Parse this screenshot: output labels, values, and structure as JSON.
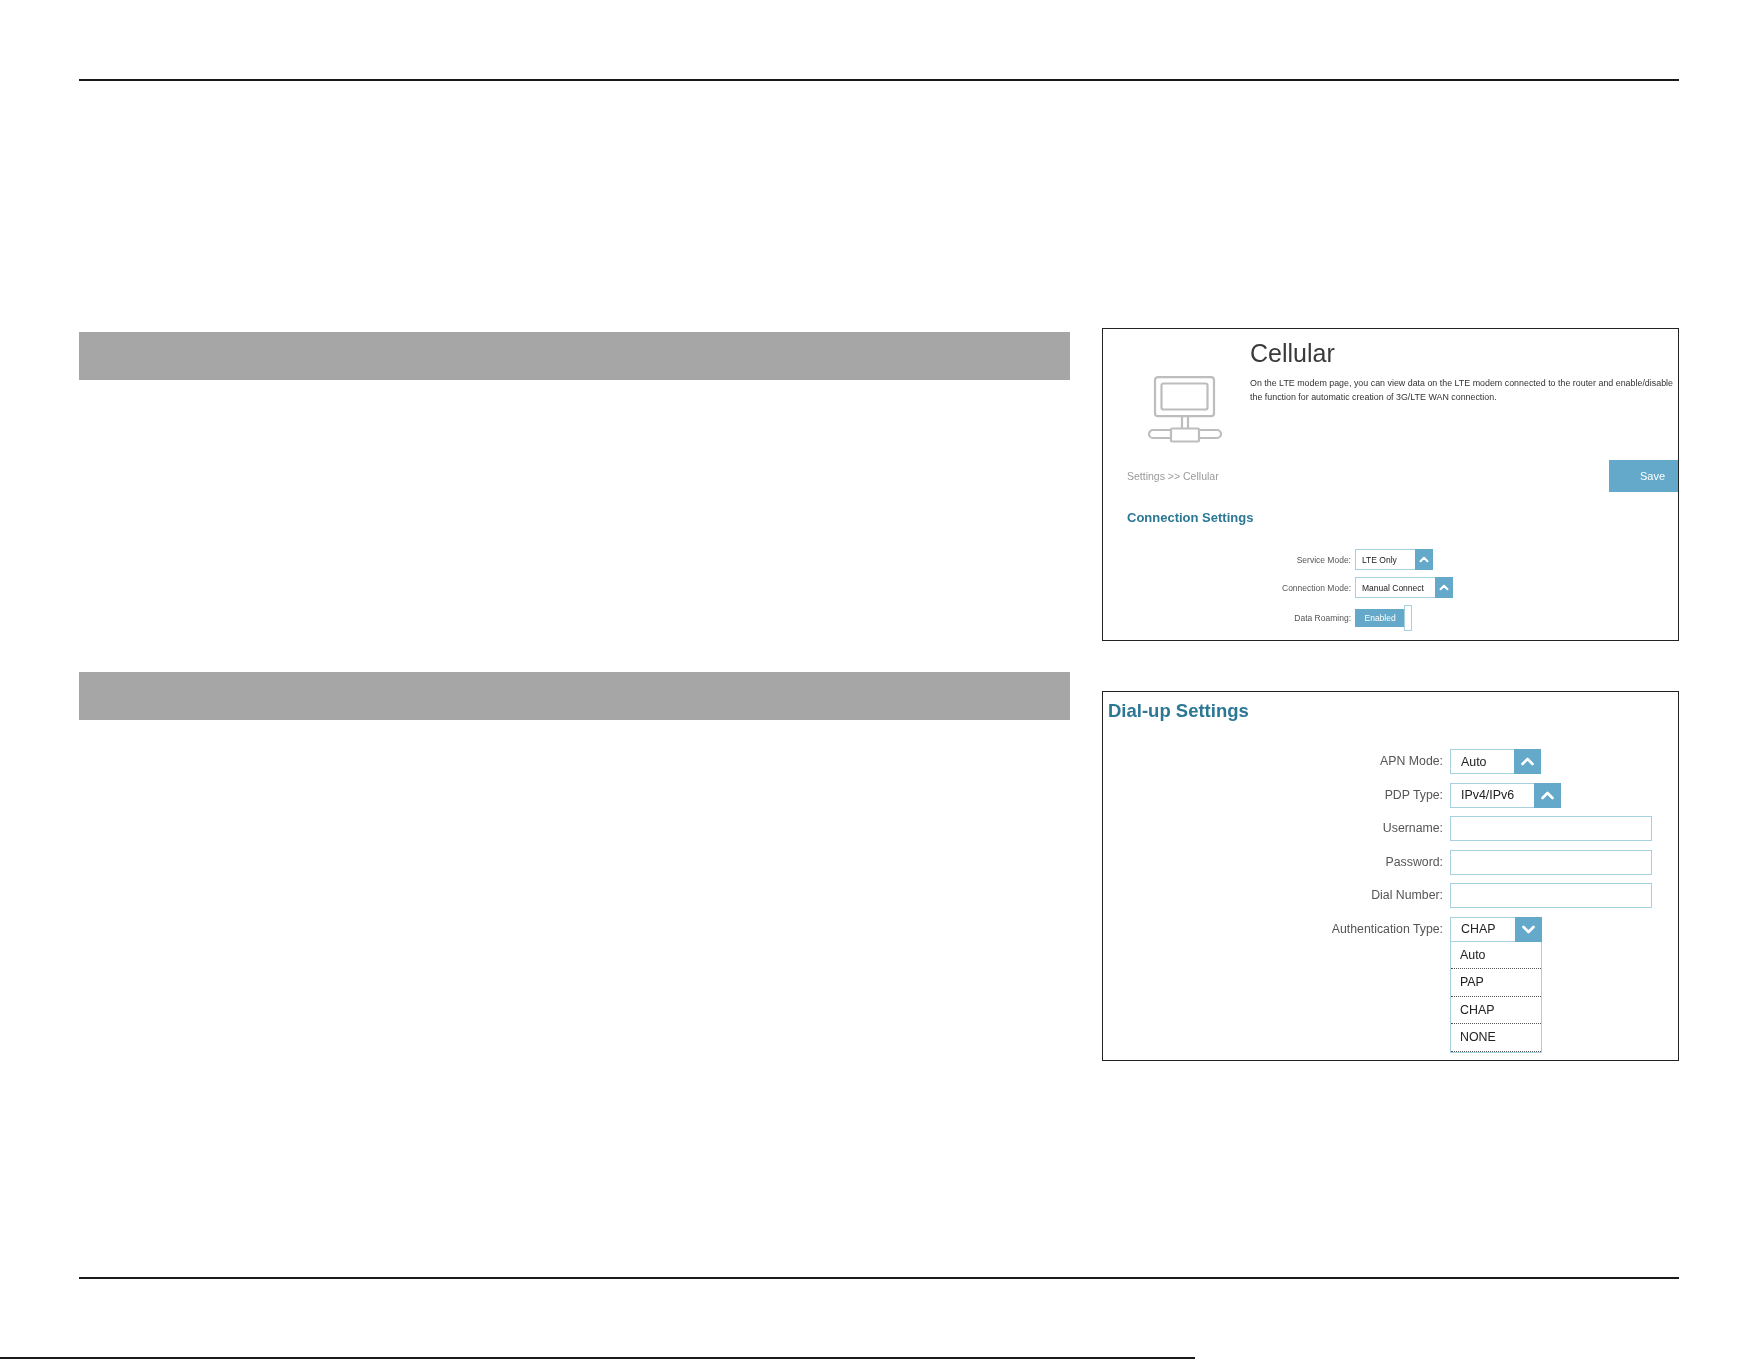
{
  "sections": [
    {
      "screenshot": {
        "title": "Cellular",
        "description": "On the LTE modem page, you can view data on the LTE modem connected to the router and enable/disable the function for automatic creation of 3G/LTE WAN connection.",
        "breadcrumb": "Settings >> Cellular",
        "button": "Save",
        "heading": "Connection Settings",
        "rows": [
          {
            "kind": "select",
            "label": "Service Mode:",
            "value": "LTE Only",
            "expanded": false
          },
          {
            "kind": "select",
            "label": "Connection Mode:",
            "value": "Manual Connect",
            "expanded": false
          },
          {
            "kind": "toggle",
            "label": "Data Roaming:",
            "value": "Enabled",
            "on": true
          }
        ]
      }
    },
    {
      "screenshot": {
        "heading": "Dial-up Settings",
        "rows": [
          {
            "kind": "select",
            "label": "APN Mode:",
            "value": "Auto",
            "expanded": false
          },
          {
            "kind": "select",
            "label": "PDP Type:",
            "value": "IPv4/IPv6",
            "expanded": false
          },
          {
            "kind": "input",
            "label": "Username:"
          },
          {
            "kind": "input",
            "label": "Password:"
          },
          {
            "kind": "input",
            "label": "Dial Number:"
          },
          {
            "kind": "select",
            "label": "Authentication Type:",
            "value": "CHAP",
            "expanded": true,
            "options": [
              "Auto",
              "PAP",
              "CHAP",
              "NONE"
            ]
          }
        ]
      }
    }
  ]
}
